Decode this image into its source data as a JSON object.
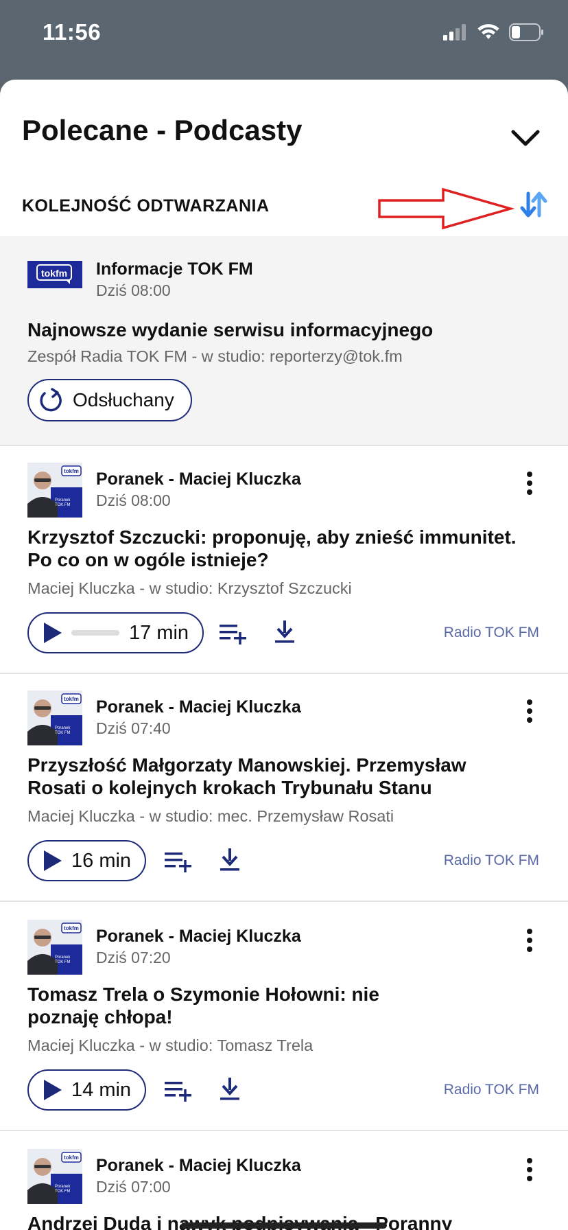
{
  "status": {
    "time": "11:56",
    "icons": [
      "cellular-signal-icon",
      "wifi-icon",
      "battery-icon"
    ]
  },
  "header": {
    "title": "Polecane - Podcasty",
    "order_label": "KOLEJNOŚĆ ODTWARZANIA"
  },
  "colors": {
    "accent": "#1d2a7a",
    "sort_icon": "#3b8cf0",
    "annotation": "#e02020",
    "source_text": "#5a6aa8"
  },
  "items": [
    {
      "show": "Informacje TOK FM",
      "time": "Dziś 08:00",
      "title": "Najnowsze wydanie serwisu informacyjnego",
      "subtitle": "Zespół Radia TOK FM  - w studio: reporterzy@tok.fm",
      "status_button": "Odsłuchany",
      "logo_text": "tokfm"
    },
    {
      "show": "Poranek - Maciej Kluczka",
      "time": "Dziś 08:00",
      "title_line1": "Krzysztof Szczucki: proponuję, aby znieść immunitet.",
      "title_line2": "Po co on w ogóle istnieje?",
      "subtitle": "Maciej Kluczka - w studio: Krzysztof Szczucki",
      "duration": "17 min",
      "progress": 0.0,
      "source": "Radio TOK FM"
    },
    {
      "show": "Poranek - Maciej Kluczka",
      "time": "Dziś 07:40",
      "title_line1": "Przyszłość Małgorzaty Manowskiej. Przemysław",
      "title_line2": "Rosati o kolejnych krokach Trybunału Stanu",
      "subtitle": "Maciej Kluczka - w studio: mec. Przemysław Rosati",
      "duration": "16 min",
      "source": "Radio TOK FM"
    },
    {
      "show": "Poranek - Maciej Kluczka",
      "time": "Dziś 07:20",
      "title_line1": "Tomasz Trela o Szymonie Hołowni: nie",
      "title_line2": "poznaję chłopa!",
      "subtitle": "Maciej Kluczka - w studio: Tomasz Trela",
      "duration": "14 min",
      "source": "Radio TOK FM"
    },
    {
      "show": "Poranek - Maciej Kluczka",
      "time": "Dziś 07:00",
      "title_line1": "Andrzej Duda i nawyk podpisywania - Poranny"
    }
  ],
  "thumb_text": {
    "badge": "tokfm",
    "caption": "Poranek TOK FM"
  }
}
